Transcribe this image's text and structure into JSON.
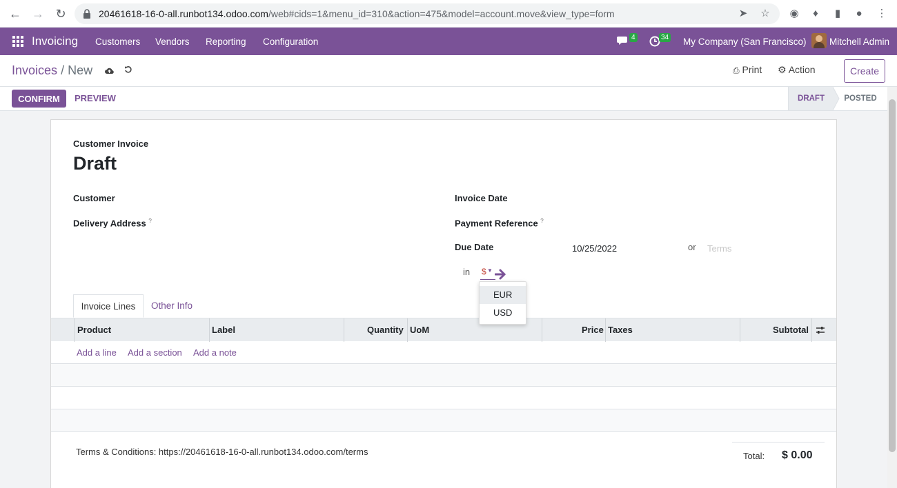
{
  "browser": {
    "url_host": "20461618-16-0-all.runbot134.odoo.com",
    "url_path": "/web#cids=1&menu_id=310&action=475&model=account.move&view_type=form"
  },
  "nav": {
    "app_name": "Invoicing",
    "menu": [
      "Customers",
      "Vendors",
      "Reporting",
      "Configuration"
    ],
    "messages_count": "4",
    "activities_count": "34",
    "company": "My Company (San Francisco)",
    "user": "Mitchell Admin",
    "accent": "#7a5297"
  },
  "control_panel": {
    "breadcrumb_parent": "Invoices",
    "breadcrumb_sep": "/",
    "breadcrumb_current": "New",
    "print_label": "Print",
    "action_label": "Action",
    "create_label": "Create"
  },
  "statusbar": {
    "confirm_label": "CONFIRM",
    "preview_label": "PREVIEW",
    "stages": [
      "DRAFT",
      "POSTED"
    ],
    "active_stage": "DRAFT"
  },
  "form": {
    "doc_type": "Customer Invoice",
    "title": "Draft",
    "customer_label": "Customer",
    "delivery_label": "Delivery Address",
    "help_mark": "?",
    "invoice_date_label": "Invoice Date",
    "payment_ref_label": "Payment Reference",
    "due_date_label": "Due Date",
    "due_date_value": "10/25/2022",
    "or_label": "or",
    "terms_placeholder": "Terms",
    "in_label": "in",
    "currency_value": "$"
  },
  "tabs": [
    "Invoice Lines",
    "Other Info"
  ],
  "table": {
    "columns": [
      "Product",
      "Label",
      "Quantity",
      "UoM",
      "Price",
      "Taxes",
      "Subtotal"
    ],
    "add_links": [
      "Add a line",
      "Add a section",
      "Add a note"
    ]
  },
  "footer": {
    "terms": "Terms & Conditions: https://20461618-16-0-all.runbot134.odoo.com/terms",
    "total_label": "Total:",
    "total_value": "$ 0.00"
  },
  "currency_dropdown": {
    "options": [
      "EUR",
      "USD"
    ],
    "highlighted": "EUR"
  }
}
